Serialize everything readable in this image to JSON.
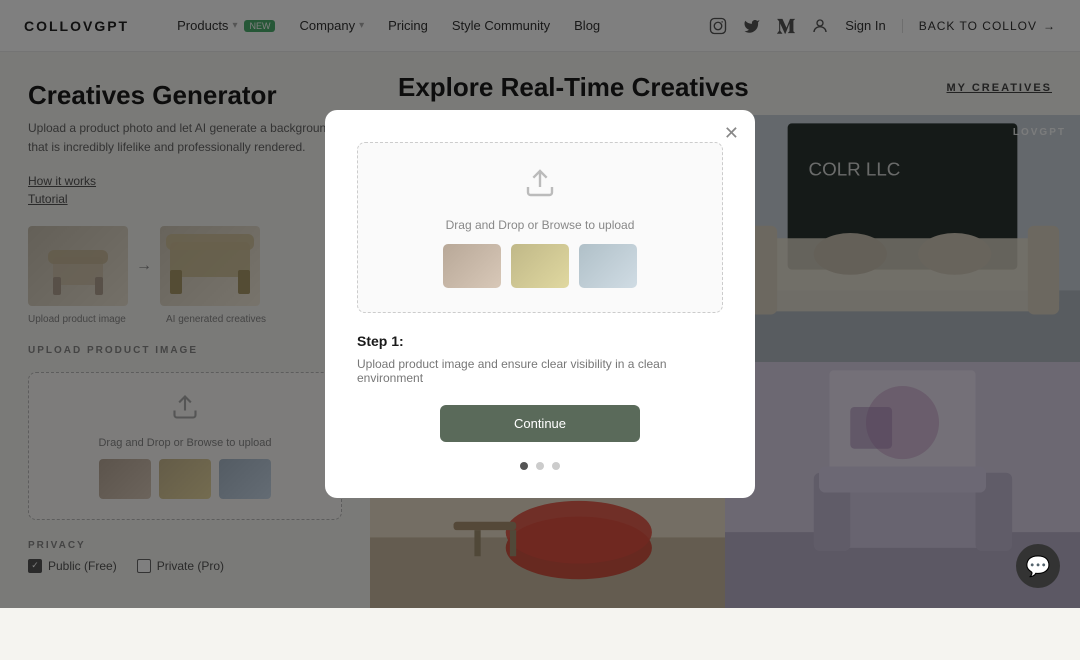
{
  "navbar": {
    "logo": "COLLOVGPT",
    "links": [
      {
        "label": "Products",
        "has_dropdown": true,
        "badge": "NEW"
      },
      {
        "label": "Company",
        "has_dropdown": true
      },
      {
        "label": "Pricing"
      },
      {
        "label": "Style Community"
      },
      {
        "label": "Blog"
      }
    ],
    "signin_label": "Sign In",
    "back_label": "BACK TO COLLOV",
    "icons": [
      "instagram-icon",
      "twitter-icon",
      "medium-icon",
      "user-icon"
    ]
  },
  "left_panel": {
    "title": "Creatives Generator",
    "subtitle": "Upload a product photo and let AI generate a background that is incredibly lifelike and professionally rendered.",
    "how_it_works": "How it works",
    "tutorial": "Tutorial",
    "sample_labels": [
      "Upload product image",
      "AI generated creatives"
    ],
    "upload_section_label": "UPLOAD PRODUCT IMAGE",
    "upload_text": "Drag and Drop or Browse to upload",
    "privacy_label": "PRIVACY",
    "privacy_options": [
      {
        "label": "Public (Free)",
        "checked": true
      },
      {
        "label": "Private (Pro)",
        "checked": false
      }
    ]
  },
  "right_panel": {
    "title": "Explore Real-Time Creatives",
    "my_creatives_label": "MY CREATIVES",
    "overlay_label": "LOVGPT"
  },
  "modal": {
    "upload_text": "Drag and Drop or Browse to upload",
    "step_label": "Step 1:",
    "step_description": "Upload product image and ensure clear visibility in a clean environment",
    "continue_label": "Continue",
    "dots": [
      {
        "active": true
      },
      {
        "active": false
      },
      {
        "active": false
      }
    ]
  },
  "chat": {
    "icon": "💬"
  }
}
